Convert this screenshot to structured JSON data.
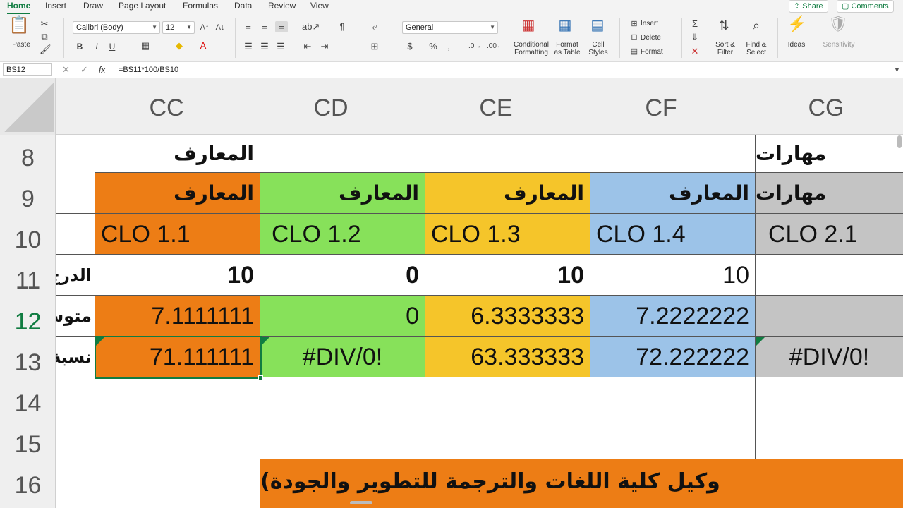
{
  "colors": {
    "accent": "#107c41",
    "orange": "#ed7d15",
    "green": "#87e15a",
    "yellow": "#f5c52a",
    "blue": "#9cc3e8",
    "gray": "#c4c4c4"
  },
  "ribbon_tabs": [
    "Home",
    "Insert",
    "Draw",
    "Page Layout",
    "Formulas",
    "Data",
    "Review",
    "View"
  ],
  "share_label": "Share",
  "comments_label": "Comments",
  "ribbon": {
    "paste_label": "Paste",
    "font_name": "Calibri (Body)",
    "font_size": "12",
    "number_format": "General",
    "conditional_formatting_label": "Conditional\nFormatting",
    "format_as_table_label": "Format\nas Table",
    "cell_styles_label": "Cell\nStyles",
    "insert_label": "Insert",
    "delete_label": "Delete",
    "format_label": "Format",
    "sort_filter_label": "Sort &\nFilter",
    "find_select_label": "Find &\nSelect",
    "ideas_label": "Ideas",
    "sensitivity_label": "Sensitivity",
    "bold": "B",
    "italic": "I",
    "underline": "U"
  },
  "formula_bar": {
    "name_box": "BS12",
    "formula": "=BS11*100/BS10"
  },
  "columns": [
    "CC",
    "CD",
    "CE",
    "CF",
    "CG"
  ],
  "rows": [
    "8",
    "9",
    "10",
    "11",
    "12",
    "13",
    "14",
    "15",
    "16"
  ],
  "selected_row": "12",
  "partial_column_labels": {
    "r11": "الدرج",
    "r12": "متوس",
    "r13": "نسبة"
  },
  "cells": {
    "r8": [
      "المعارف",
      "",
      "",
      "",
      "مهارات"
    ],
    "r9": [
      "المعارف",
      "المعارف",
      "المعارف",
      "المعارف",
      "مهارات"
    ],
    "r10": [
      "CLO 1.1",
      "CLO 1.2",
      "CLO 1.3",
      "CLO 1.4",
      "CLO 2.1"
    ],
    "r11": [
      "10",
      "0",
      "10",
      "10",
      ""
    ],
    "r12": [
      "7.1111111",
      "0",
      "6.3333333",
      "7.2222222",
      ""
    ],
    "r13": [
      "71.111111",
      "#DIV/0!",
      "63.333333",
      "72.222222",
      "#DIV/0!"
    ],
    "r16_banner": "وكيل كلية اللغات والترجمة للتطوير والجودة)"
  }
}
